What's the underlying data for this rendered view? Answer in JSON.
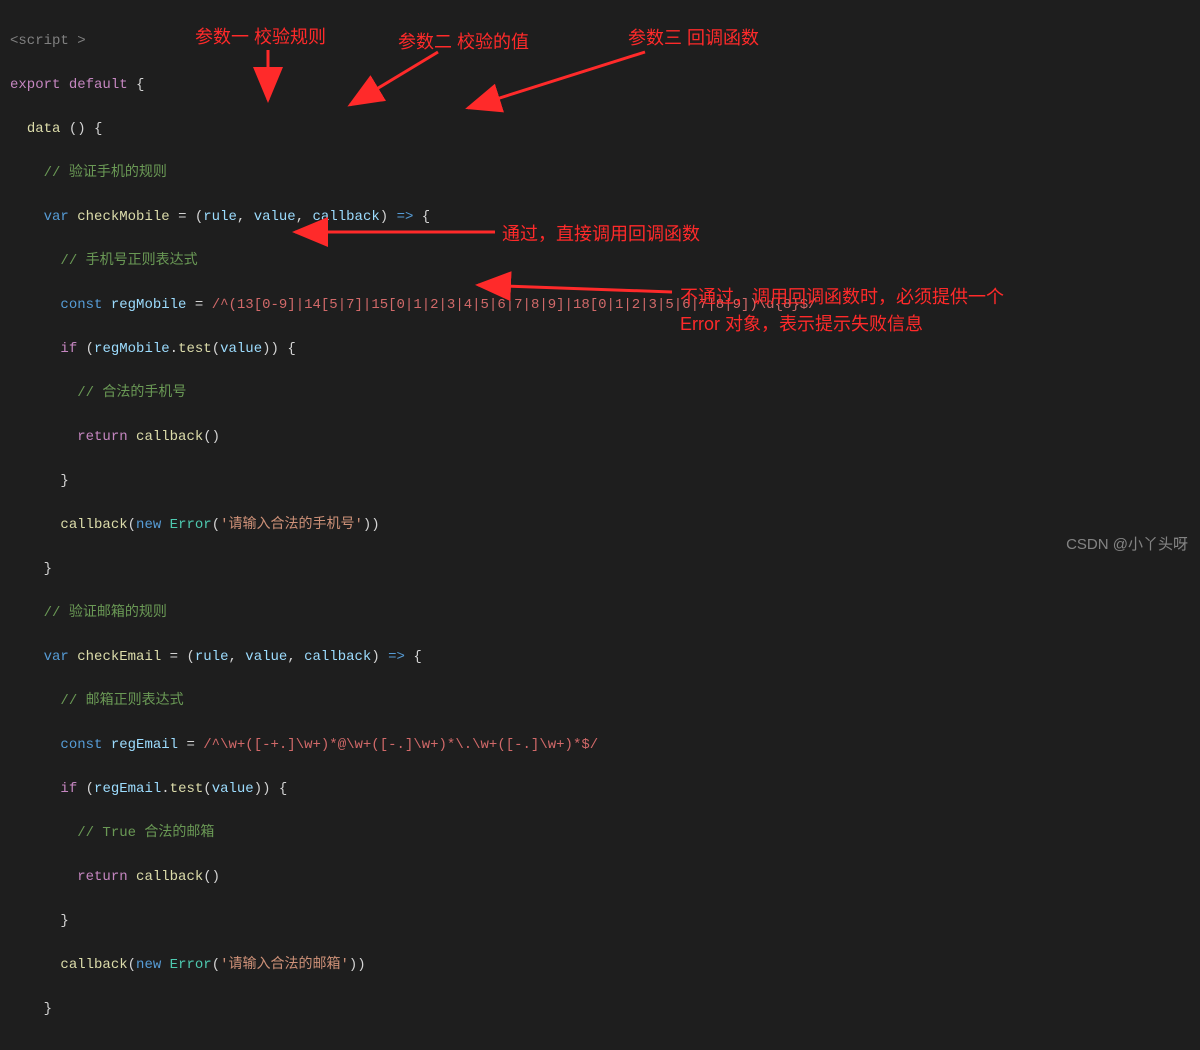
{
  "code": {
    "l1_script_open": "<script >",
    "l2_export": "export",
    "l2_default": "default",
    "l3_data": "data",
    "l4_cm_mobile_rule": "// 验证手机的规则",
    "l5_var": "var",
    "l5_checkMobile": "checkMobile",
    "l5_rule": "rule",
    "l5_value": "value",
    "l5_callback": "callback",
    "l6_cm_phone_regex": "// 手机号正则表达式",
    "l7_const": "const",
    "l7_regMobile": "regMobile",
    "l7_regex": "/^(13[0-9]|14[5|7]|15[0|1|2|3|4|5|6|7|8|9]|18[0|1|2|3|5|6|7|8|9])\\d{8}$/",
    "l8_if": "if",
    "l8_test": "test",
    "l9_cm_valid": "// 合法的手机号",
    "l10_return": "return",
    "l12_new": "new",
    "l12_Error": "Error",
    "l12_err_msg": "'请输入合法的手机号'",
    "l14_cm_email_rule": "// 验证邮箱的规则",
    "l15_checkEmail": "checkEmail",
    "l16_cm_email_regex": "// 邮箱正则表达式",
    "l17_regEmail": "regEmail",
    "l17_regex": "/^\\w+([-+.]\\w+)*@\\w+([-.]\\w+)*\\.\\w+([-.]\\w+)*$/",
    "l19_cm_true": "// True 合法的邮箱",
    "l22_err_msg": "'请输入合法的邮箱'"
  },
  "annotations": {
    "param1": "参数一 校验规则",
    "param2": "参数二 校验的值",
    "param3": "参数三 回调函数",
    "pass": "通过，直接调用回调函数",
    "fail_l1": "不通过，调用回调函数时，必须提供一个",
    "fail_l2": "Error 对象，表示提示失败信息"
  },
  "watermark": "CSDN @小丫头呀",
  "colors": {
    "annotation_red": "#ff2a2a",
    "bg": "#1e1e1e"
  }
}
